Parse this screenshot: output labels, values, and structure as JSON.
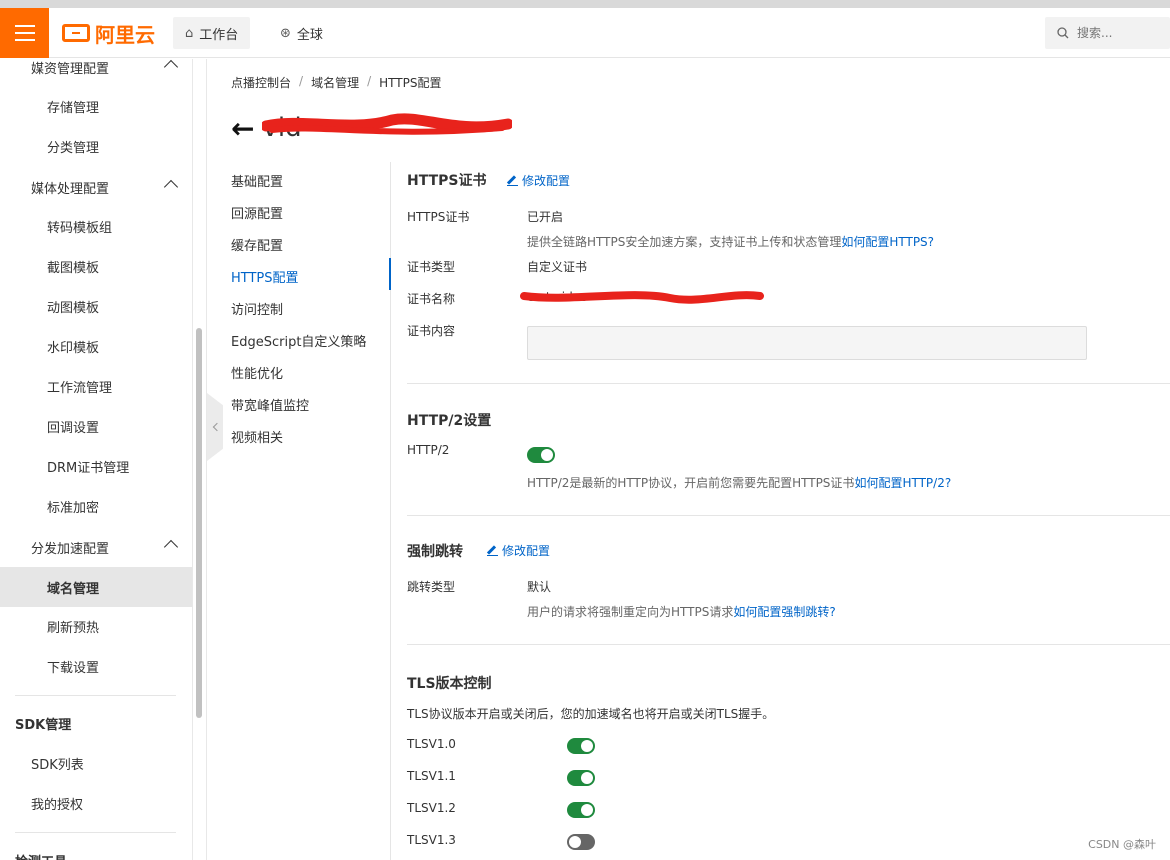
{
  "header": {
    "logo_text": "阿里云",
    "workbench_label": "工作台",
    "global_label": "全球",
    "search_placeholder": "搜索..."
  },
  "sidebar": {
    "groups": [
      {
        "label": "媒资管理配置"
      },
      {
        "label": "媒体处理配置"
      },
      {
        "label": "分发加速配置"
      }
    ],
    "items": [
      "存储管理",
      "分类管理",
      "转码模板组",
      "截图模板",
      "动图模板",
      "水印模板",
      "工作流管理",
      "回调设置",
      "DRM证书管理",
      "标准加密",
      "域名管理",
      "刷新预热",
      "下载设置"
    ],
    "active_item": "域名管理",
    "sdk_head": "SDK管理",
    "sdk_items": [
      "SDK列表",
      "我的授权"
    ],
    "bottom_head": "检测工具"
  },
  "breadcrumb": [
    "点播控制台",
    "域名管理",
    "HTTPS配置"
  ],
  "page_title": "vid",
  "subnav": [
    "基础配置",
    "回源配置",
    "缓存配置",
    "HTTPS配置",
    "访问控制",
    "EdgeScript自定义策略",
    "性能优化",
    "带宽峰值监控",
    "视频相关"
  ],
  "subnav_active": "HTTPS配置",
  "https_cert": {
    "title": "HTTPS证书",
    "edit_label": "修改配置",
    "cert_label": "HTTPS证书",
    "cert_value": "已开启",
    "cert_hint": "提供全链路HTTPS安全加速方案，支持证书上传和状态管理",
    "cert_hint_link": "如何配置HTTPS?",
    "type_label": "证书类型",
    "type_value": "自定义证书",
    "name_label": "证书名称",
    "name_value": "cert-video",
    "content_label": "证书内容"
  },
  "http2": {
    "title": "HTTP/2设置",
    "label": "HTTP/2",
    "enabled": true,
    "hint": "HTTP/2是最新的HTTP协议，开启前您需要先配置HTTPS证书",
    "hint_link": "如何配置HTTP/2?"
  },
  "redirect": {
    "title": "强制跳转",
    "edit_label": "修改配置",
    "type_label": "跳转类型",
    "type_value": "默认",
    "hint": "用户的请求将强制重定向为HTTPS请求",
    "hint_link": "如何配置强制跳转?"
  },
  "tls": {
    "title": "TLS版本控制",
    "desc": "TLS协议版本开启或关闭后，您的加速域名也将开启或关闭TLS握手。",
    "versions": [
      {
        "label": "TLSV1.0",
        "enabled": true
      },
      {
        "label": "TLSV1.1",
        "enabled": true
      },
      {
        "label": "TLSV1.2",
        "enabled": true
      },
      {
        "label": "TLSV1.3",
        "enabled": false
      }
    ]
  },
  "watermark": "CSDN @森叶",
  "colors": {
    "brand": "#ff6a00",
    "link": "#0064c8",
    "toggle_on": "#1f8a3e",
    "toggle_off": "#666666",
    "redaction": "#e8231c"
  }
}
